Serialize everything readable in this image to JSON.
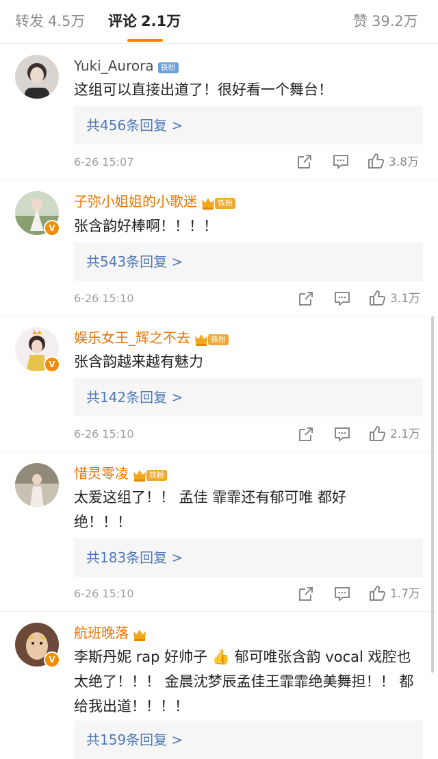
{
  "tabs": [
    {
      "label": "转发",
      "count": "4.5万"
    },
    {
      "label": "评论",
      "count": "2.1万"
    },
    {
      "label": "赞",
      "count": "39.2万"
    }
  ],
  "colors": {
    "accent": "#ff8200",
    "vip_name": "#eb7300",
    "link": "#4e79b5"
  },
  "comments": [
    {
      "user": "Yuki_Aurora",
      "fan_badge": "铁粉",
      "text": "这组可以直接出道了！很好看一个舞台！",
      "reply_label": "共456条回复 >",
      "time": "6-26 15:07",
      "likes": "3.8万"
    },
    {
      "user": "子弥小姐姐的小歌迷",
      "fan_badge": "铁粉",
      "text": "张含韵好棒啊！！！！",
      "reply_label": "共543条回复 >",
      "time": "6-26 15:10",
      "likes": "3.1万"
    },
    {
      "user": "娱乐女王_辉之不去",
      "fan_badge": "铁粉",
      "text": "张含韵越来越有魅力",
      "reply_label": "共142条回复 >",
      "time": "6-26 15:10",
      "likes": "2.1万"
    },
    {
      "user": "惜灵零凌",
      "fan_badge": "铁粉",
      "text": "太爱这组了！！ 孟佳 霏霏还有郁可唯 都好绝！！！",
      "reply_label": "共183条回复 >",
      "time": "6-26 15:10",
      "likes": "1.7万"
    },
    {
      "user": "航班晚落",
      "fan_badge": "",
      "text": "李斯丹妮 rap 好帅子 👍 郁可唯张含韵 vocal 戏腔也太绝了！！！ 金晨沈梦辰孟佳王霏霏绝美舞担！！ 都给我出道！！！！",
      "reply_label": "共159条回复 >",
      "time": "",
      "likes": ""
    }
  ],
  "icons": {
    "share": "share-icon",
    "comment": "comment-icon",
    "like": "thumbs-up-icon",
    "verified": "v-verified-icon",
    "crown": "crown-icon"
  }
}
